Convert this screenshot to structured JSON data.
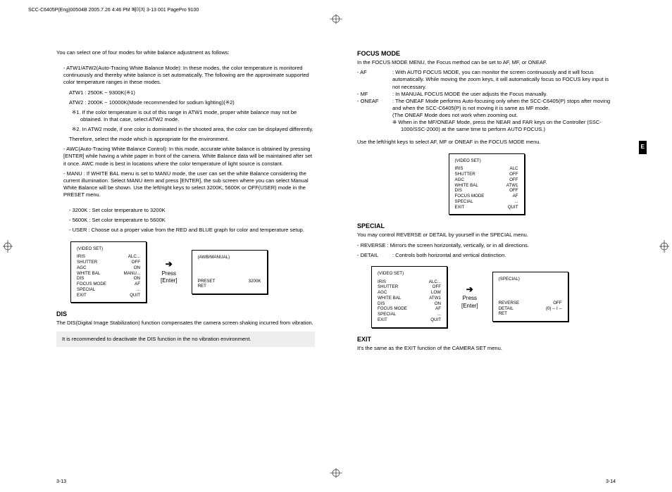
{
  "header": "SCC-C6405P(Eng)00504B  2005.7.26 4:46 PM  페이지 3-13   001 PagePro 9100",
  "e_tab": "E",
  "left": {
    "intro": "You can select one of four modes for white balance adjustment as follows:",
    "atw_intro": "-  ATW1/ATW2(Auto-Tracing White Balance Mode): In these modes, the color temperature is monitored continuously and thereby white balance is set automatically. The following are the approximate supported color temperature ranges in these modes.",
    "atw1_range": "ATW1 : 2500K ~ 9300K(※1)",
    "atw2_range": "ATW2 : 2000K ~ 10000K(Mode recommended for sodium lighting)(※2)",
    "note1": "※1. If the color temperature is out of this range in ATW1 mode, proper white balance may not be obtained. In that case, select ATW2 mode.",
    "note2": "※2.  In ATW2 mode, if one color is dominated in the shooted area, the color can be displayed differently.",
    "note_tail": "Therefore, select the mode which is appropriate for the environment.",
    "awc": "-  AWC(Auto-Tracing White Balance Control): In this mode, accurate white balance is obtained by pressing [ENTER] while having a white paper in front of the camera. White Balance data will be maintained after set it once. AWC mode is best in locations where the color temperature of light source is constant.",
    "manu": "-  MANU : If WHITE BAL menu is set to MANU mode, the user can set the white Balance considering the current illumination. Select MANU item and press [ENTER], the sub screen where you can select Manual White Balance will be shown. Use the left/right keys to select 3200K, 5600K or OFF(USER) mode in the PRESET menu.",
    "p3200": "- 3200K : Set color temperature to 3200K",
    "p5600": "- 5600K : Set color temperature to 5600K",
    "puser": "- USER   : Choose out a proper value from the RED and BLUE graph for color and temperature setup.",
    "dis_h": "DIS",
    "dis_body": "The DIS(Digital Image Stabilization) function compensates the camera screen shaking incurred from vibration.",
    "dis_note": "It is recommended to deactivate the DIS function in  the no vibration environment.",
    "menu_video_title": "(VIDEO SET)",
    "menu_video": [
      [
        "IRIS",
        "ALC..."
      ],
      [
        "SHUTTER",
        "OFF"
      ],
      [
        "AGC",
        "ON"
      ],
      [
        "WHITE BAL",
        "MANU..."
      ],
      [
        "DIS",
        "ON"
      ],
      [
        "FOCUS MODE",
        "AF"
      ],
      [
        "SPECIAL",
        "..."
      ],
      [
        "EXIT",
        "QUIT"
      ]
    ],
    "press_enter_arrow": "➔",
    "press_enter_a": "Press",
    "press_enter_b": "[Enter]",
    "menu_awb_title": "(AWB/MANUAL)",
    "menu_awb": [
      [
        "PRESET",
        "3200K"
      ],
      [
        "",
        ""
      ],
      [
        "RET",
        ""
      ]
    ],
    "pn": "3-13"
  },
  "right": {
    "focus_h": "FOCUS MODE",
    "focus_intro": "In the FOCUS MODE MENU, the Focus method can be set to AF, MF, or ONEAF.",
    "af_lbl": "- AF",
    "af": ": With AUTO FOCUS MODE, you can monitor the screen continuously and it will focus automatically. While moving the zoom keys, it will automatically focus so FOCUS key input is not necessary.",
    "mf_lbl": "- MF",
    "mf": ": In MANUAL FOCUS MODE the user adjusts the Focus manually.",
    "oneaf_lbl": "- ONEAF",
    "oneaf": ": The ONEAF Mode performs Auto-focusing only when the SCC-C6405(P) stops after moving and when the SCC-C6405(P) is not moving it is same as MF mode.",
    "oneaf_note1": "(The ONEAF Mode does not work when zooming out.",
    "oneaf_note2": "❈  When in the MF/ONEAF Mode, press the NEAR and FAR keys on the Controller (SSC-1000/SSC-2000) at the same time to perform AUTO FOCUS.)",
    "focus_use": "Use the left/right keys to select AF, MF or ONEAF in the FOCUS MODE menu.",
    "menu_focus_title": "(VIDEO SET)",
    "menu_focus": [
      [
        "IRIS",
        "ALC"
      ],
      [
        "SHUTTER",
        "OFF"
      ],
      [
        "AGC",
        "OFF"
      ],
      [
        "WHITE BAL",
        "ATW1"
      ],
      [
        "DIS",
        "OFF"
      ],
      [
        "FOCUS MODE",
        "AF"
      ],
      [
        "SPECIAL",
        "..."
      ],
      [
        "EXIT",
        "QUIT"
      ]
    ],
    "special_h": "SPECIAL",
    "special_intro": "You may control REVERSE or DETAIL by yourself in the SPECIAL menu.",
    "reverse": "- REVERSE : Mirrors the screen horizontally, vertically, or in all directions.",
    "detail_lbl": "- DETAIL",
    "detail": ": Controls both horizontal and vertical distinction.",
    "menu_sp_video_title": "(VIDEO SET)",
    "menu_sp_video": [
      [
        "IRIS",
        "ALC..."
      ],
      [
        "SHUTTER",
        "OFF"
      ],
      [
        "AGC",
        "LOW"
      ],
      [
        "WHITE BAL",
        "ATW1"
      ],
      [
        "DIS",
        "ON"
      ],
      [
        "FOCUS MODE",
        "AF"
      ],
      [
        "SPECIAL",
        "..."
      ],
      [
        "EXIT",
        "QUIT"
      ]
    ],
    "menu_special_title": "(SPECIAL)",
    "menu_special": [
      [
        "REVERSE",
        "OFF"
      ],
      [
        "DETAIL",
        "(0) -- I --"
      ],
      [
        "RET",
        ""
      ]
    ],
    "exit_h": "EXIT",
    "exit_body": "It's the same as the EXIT function of the CAMERA SET menu.",
    "pn": "3-14"
  }
}
